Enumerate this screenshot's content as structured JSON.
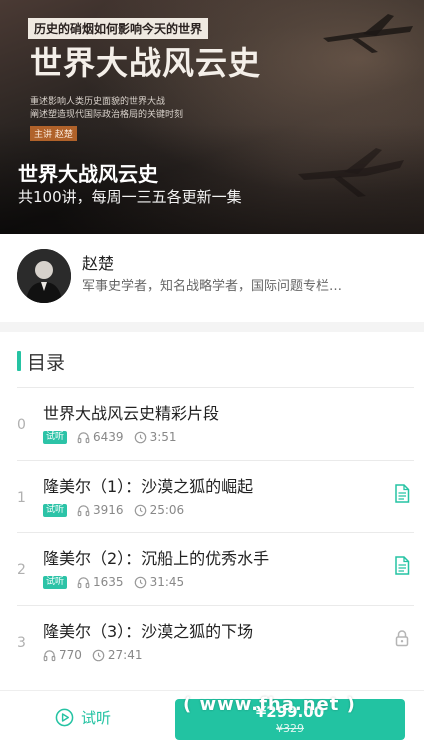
{
  "hero": {
    "cover_tagline": "历史的硝烟如何影响今天的世界",
    "cover_title": "世界大战风云史",
    "cover_desc": [
      "重述影响人类历史面貌的世界大战",
      "阐述塑造现代国际政治格局的关键时刻"
    ],
    "cover_host": "主讲 赵楚",
    "title": "世界大战风云史",
    "subtitle": "共100讲，每周一三五各更新一集"
  },
  "author": {
    "name": "赵楚",
    "desc": "军事史学者，知名战略学者，国际问题专栏…"
  },
  "toc": {
    "title": "目录",
    "items": [
      {
        "num": "0",
        "title": "世界大战风云史精彩片段",
        "trial": "试听",
        "plays": "6439",
        "duration": "3:51",
        "side_icon": ""
      },
      {
        "num": "1",
        "title": "隆美尔（1）：沙漠之狐的崛起",
        "trial": "试听",
        "plays": "3916",
        "duration": "25:06",
        "side_icon": "document-icon"
      },
      {
        "num": "2",
        "title": "隆美尔（2）：沉船上的优秀水手",
        "trial": "试听",
        "plays": "1635",
        "duration": "31:45",
        "side_icon": "document-icon"
      },
      {
        "num": "3",
        "title": "隆美尔（3）：沙漠之狐的下场",
        "trial": "",
        "plays": "770",
        "duration": "27:41",
        "side_icon": "lock-icon"
      }
    ]
  },
  "bottom": {
    "trial_label": "试听",
    "price": "¥299.00",
    "old_price": "¥329",
    "watermark": "( www.fha.net )"
  },
  "colors": {
    "accent": "#22c3a2",
    "hero_dark": "#1a1716"
  }
}
